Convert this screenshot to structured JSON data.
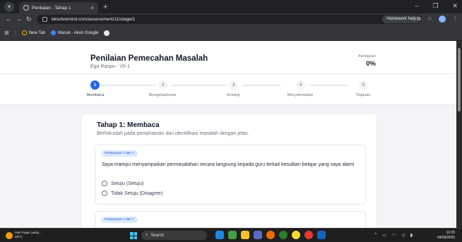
{
  "browser": {
    "tab_title": "Penilaian - Tahap 1",
    "url": "bksolvemind.com/assessment/11/stage/1",
    "homework_help": "Homework help",
    "bookmarks": [
      "New Tab",
      "Masuk - Akun Google"
    ]
  },
  "header": {
    "title": "Penilaian Pemecahan Masalah",
    "subtitle": "Ega Ranpo - VII-1",
    "progress_label": "Kemajuan",
    "progress_value": "0%"
  },
  "stepper": {
    "steps": [
      {
        "num": "1",
        "label": "Membaca"
      },
      {
        "num": "2",
        "label": "Mengeksplorasi"
      },
      {
        "num": "3",
        "label": "Strategi"
      },
      {
        "num": "4",
        "label": "Menyelesaikan"
      },
      {
        "num": "5",
        "label": "Tinjauan"
      }
    ],
    "active_index": 0
  },
  "stage": {
    "title": "Tahap 1: Membaca",
    "description": "Berfokuslah pada pemahaman dan identifikasi masalah dengan jelas."
  },
  "questions": [
    {
      "badge": "Pertanyaan 1 dari 7",
      "text": "Saya mampu menyampaikan permasalahan secara langsung kepada guru terkait kesulitan belajar yang saya alami",
      "options": [
        "Setuju (Setuju)",
        "Tidak Setuju (Disagree)"
      ]
    },
    {
      "badge": "Pertanyaan 2 dari 7"
    }
  ],
  "taskbar": {
    "weather_line1": "Hari hujan yang...",
    "weather_line2": "29°C",
    "search_label": "Search",
    "time": "12:05",
    "date": "04/09/2025"
  },
  "colors": {
    "accent": "#2563eb",
    "badge_bg": "#dbeafe",
    "badge_text": "#1d4ed8"
  }
}
